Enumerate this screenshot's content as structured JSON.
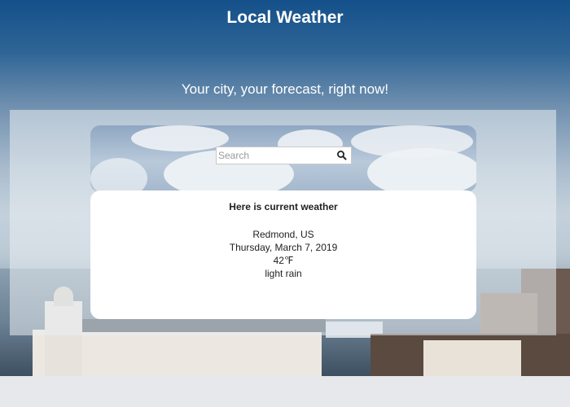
{
  "header": {
    "title": "Local Weather",
    "tagline": "Your city, your forecast, right now!"
  },
  "search": {
    "placeholder": "Search",
    "value": "",
    "icon": "search-icon"
  },
  "weather": {
    "heading": "Here is current weather",
    "location": "Redmond, US",
    "date": "Thursday, March 7, 2019",
    "temperature": "42℉",
    "condition": "light rain"
  },
  "colors": {
    "title_text": "#ffffff",
    "card_background": "#ffffff",
    "sky_top": "#14508a"
  }
}
